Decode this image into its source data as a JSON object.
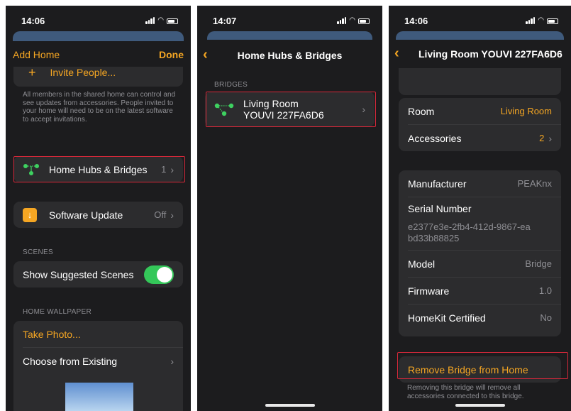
{
  "screen1": {
    "time": "14:06",
    "nav": {
      "left": "Add Home",
      "right": "Done"
    },
    "invite_label": "Invite People...",
    "invite_note": "All members in the shared home can control and see updates from accessories. People invited to your home will need to be on the latest software to accept invitations.",
    "hubs_label": "Home Hubs & Bridges",
    "hubs_value": "1",
    "software_label": "Software Update",
    "software_value": "Off",
    "scenes_header": "SCENES",
    "suggested_label": "Show Suggested Scenes",
    "wallpaper_header": "HOME WALLPAPER",
    "take_photo": "Take Photo...",
    "choose_existing": "Choose from Existing"
  },
  "screen2": {
    "time": "14:07",
    "nav_title": "Home Hubs & Bridges",
    "section_header": "BRIDGES",
    "bridge_room": "Living Room",
    "bridge_name": "YOUVI 227FA6D6"
  },
  "screen3": {
    "time": "14:06",
    "nav_title": "Living Room YOUVI 227FA6D6",
    "room_label": "Room",
    "room_value": "Living Room",
    "accessories_label": "Accessories",
    "accessories_value": "2",
    "manufacturer_label": "Manufacturer",
    "manufacturer_value": "PEAKnx",
    "serial_label": "Serial Number",
    "serial_value": "e2377e3e-2fb4-412d-9867-eabd33b88825",
    "model_label": "Model",
    "model_value": "Bridge",
    "firmware_label": "Firmware",
    "firmware_value": "1.0",
    "homekit_label": "HomeKit Certified",
    "homekit_value": "No",
    "remove_label": "Remove Bridge from Home",
    "remove_note": "Removing this bridge will remove all accessories connected to this bridge."
  },
  "colors": {
    "accent": "#f5a623",
    "highlight": "#d6283a",
    "toggle_on": "#34c759",
    "background": "#1c1c1e",
    "card": "#2c2c2e"
  },
  "icons": [
    "hub-icon",
    "software-update-icon",
    "plus-icon",
    "chevron-right-icon",
    "back-chevron-icon"
  ]
}
